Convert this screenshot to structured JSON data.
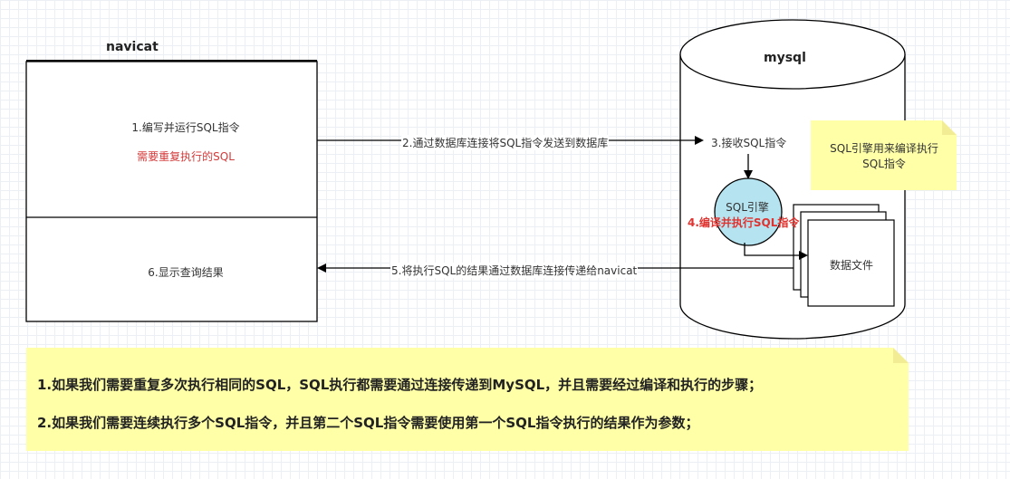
{
  "navicat": {
    "title": "navicat",
    "step1": "1.编写并运行SQL指令",
    "red_note": "需要重复执行的SQL",
    "step6": "6.显示查询结果"
  },
  "mysql": {
    "title": "mysql",
    "step3": "3.接收SQL指令",
    "engine": "SQL引擎",
    "step4": "4.编译并执行SQL指令",
    "data_file": "数据文件"
  },
  "arrows": {
    "send": "2.通过数据库连接将SQL指令发送到数据库",
    "return": "5.将执行SQL的结果通过数据库连接传递给navicat"
  },
  "notes": {
    "engine_note": [
      "SQL引擎用来编译执行",
      "SQL指令"
    ],
    "bottom_line1": "1.如果我们需要重复多次执行相同的SQL，SQL执行都需要通过连接传递到MySQL，并且需要经过编译和执行的步骤；",
    "bottom_line2": "2.如果我们需要连续执行多个SQL指令，并且第二个SQL指令需要使用第一个SQL指令执行的结果作为参数；"
  },
  "colors": {
    "note_fill": "#ffffa8",
    "note_fold": "#f2ed94",
    "engine_fill": "#b5e3f0",
    "red": "#d33a3a",
    "stroke": "#000000"
  }
}
